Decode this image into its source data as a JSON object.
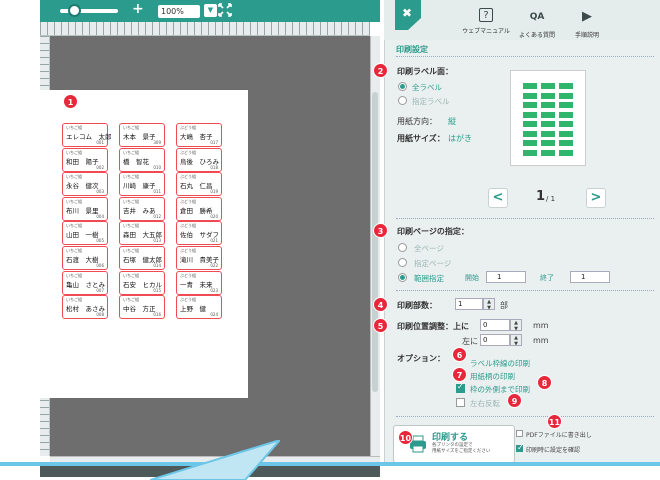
{
  "toolbar": {
    "zoom_plus": "+",
    "zoom_value": "100%",
    "zoom_arrow": "▼"
  },
  "labels": [
    {
      "kana": "いちご組",
      "name": "エレコム　太郎",
      "code": "001"
    },
    {
      "kana": "いちご組",
      "name": "木本　景子",
      "code": "309"
    },
    {
      "kana": "ぶどう組",
      "name": "大嶋　杏子",
      "code": "017"
    },
    {
      "kana": "いちご組",
      "name": "和田　陽子",
      "code": "002"
    },
    {
      "kana": "いちご組",
      "name": "橋　智花",
      "code": "010"
    },
    {
      "kana": "ぶどう組",
      "name": "烏後　ひろみ",
      "code": "018"
    },
    {
      "kana": "いちご組",
      "name": "永谷　健次",
      "code": "003"
    },
    {
      "kana": "いちご組",
      "name": "川崎　康子",
      "code": "011"
    },
    {
      "kana": "ぶどう組",
      "name": "石丸　仁昌",
      "code": "019"
    },
    {
      "kana": "いちご組",
      "name": "布川　景里",
      "code": "004"
    },
    {
      "kana": "いちご組",
      "name": "吉井　みあ",
      "code": "012"
    },
    {
      "kana": "ぶどう組",
      "name": "倉田　勝希",
      "code": "020"
    },
    {
      "kana": "いちご組",
      "name": "山田　一樹",
      "code": "005"
    },
    {
      "kana": "いちご組",
      "name": "森田　大五郎",
      "code": "013"
    },
    {
      "kana": "ぶどう組",
      "name": "佐伯　サダフ",
      "code": "021"
    },
    {
      "kana": "いちご組",
      "name": "石渡　大樹",
      "code": "006"
    },
    {
      "kana": "いちご組",
      "name": "石塚　健太郎",
      "code": "014"
    },
    {
      "kana": "ぶどう組",
      "name": "滝川　貴美子",
      "code": "022"
    },
    {
      "kana": "いちご組",
      "name": "亀山　さとみ",
      "code": "007"
    },
    {
      "kana": "いちご組",
      "name": "石安　ヒカル",
      "code": "015"
    },
    {
      "kana": "ぶどう組",
      "name": "一青　未来",
      "code": "023"
    },
    {
      "kana": "いちご組",
      "name": "松村　あさみ",
      "code": "008"
    },
    {
      "kana": "いちご組",
      "name": "中谷　方正",
      "code": "016"
    },
    {
      "kana": "ぶどう組",
      "name": "上野　健",
      "code": "024"
    }
  ],
  "header": {
    "close": "✖",
    "icons": [
      {
        "label": "ウェブマニュアル",
        "glyph": "?"
      },
      {
        "label": "よくある質問",
        "glyph": "QA"
      },
      {
        "label": "手順説明",
        "glyph": "▶"
      }
    ]
  },
  "panel": {
    "title": "印刷設定",
    "label_side": {
      "heading": "印刷ラベル面：",
      "opt_all": "全ラベル",
      "opt_sel": "指定ラベル"
    },
    "orientation": {
      "label": "用紙方向：",
      "value": "縦"
    },
    "paper_size": {
      "label": "用紙サイズ：",
      "value": "はがき"
    },
    "pager": {
      "current": "1",
      "total": "/ 1",
      "prev": "<",
      "next": ">"
    },
    "page_range": {
      "heading": "印刷ページの指定：",
      "opt_all": "全ページ",
      "opt_sel": "指定ページ",
      "opt_range": "範囲指定",
      "start_label": "開始",
      "start_value": "1",
      "end_label": "終了",
      "end_value": "1"
    },
    "copies": {
      "label": "印刷部数：",
      "value": "1",
      "unit": "部"
    },
    "offset": {
      "label": "印刷位置調整：上に",
      "left_label": "左に",
      "top_value": "0",
      "left_value": "0",
      "unit": "mm"
    },
    "options": {
      "label": "オプション：",
      "frame": "ラベル枠線の印刷",
      "pattern": "用紙柄の印刷",
      "outside": "枠の外側まで印刷",
      "mirror": "左右反転"
    },
    "print_button": {
      "label": "印刷する",
      "sub1": "各プリンタの設定で",
      "sub2": "用紙サイズをご指定ください"
    },
    "pdf": "PDFファイルに書き出し",
    "confirm": "印刷時に設定を確認"
  },
  "markers": [
    "1",
    "2",
    "3",
    "4",
    "5",
    "6",
    "7",
    "8",
    "9",
    "10",
    "11"
  ]
}
